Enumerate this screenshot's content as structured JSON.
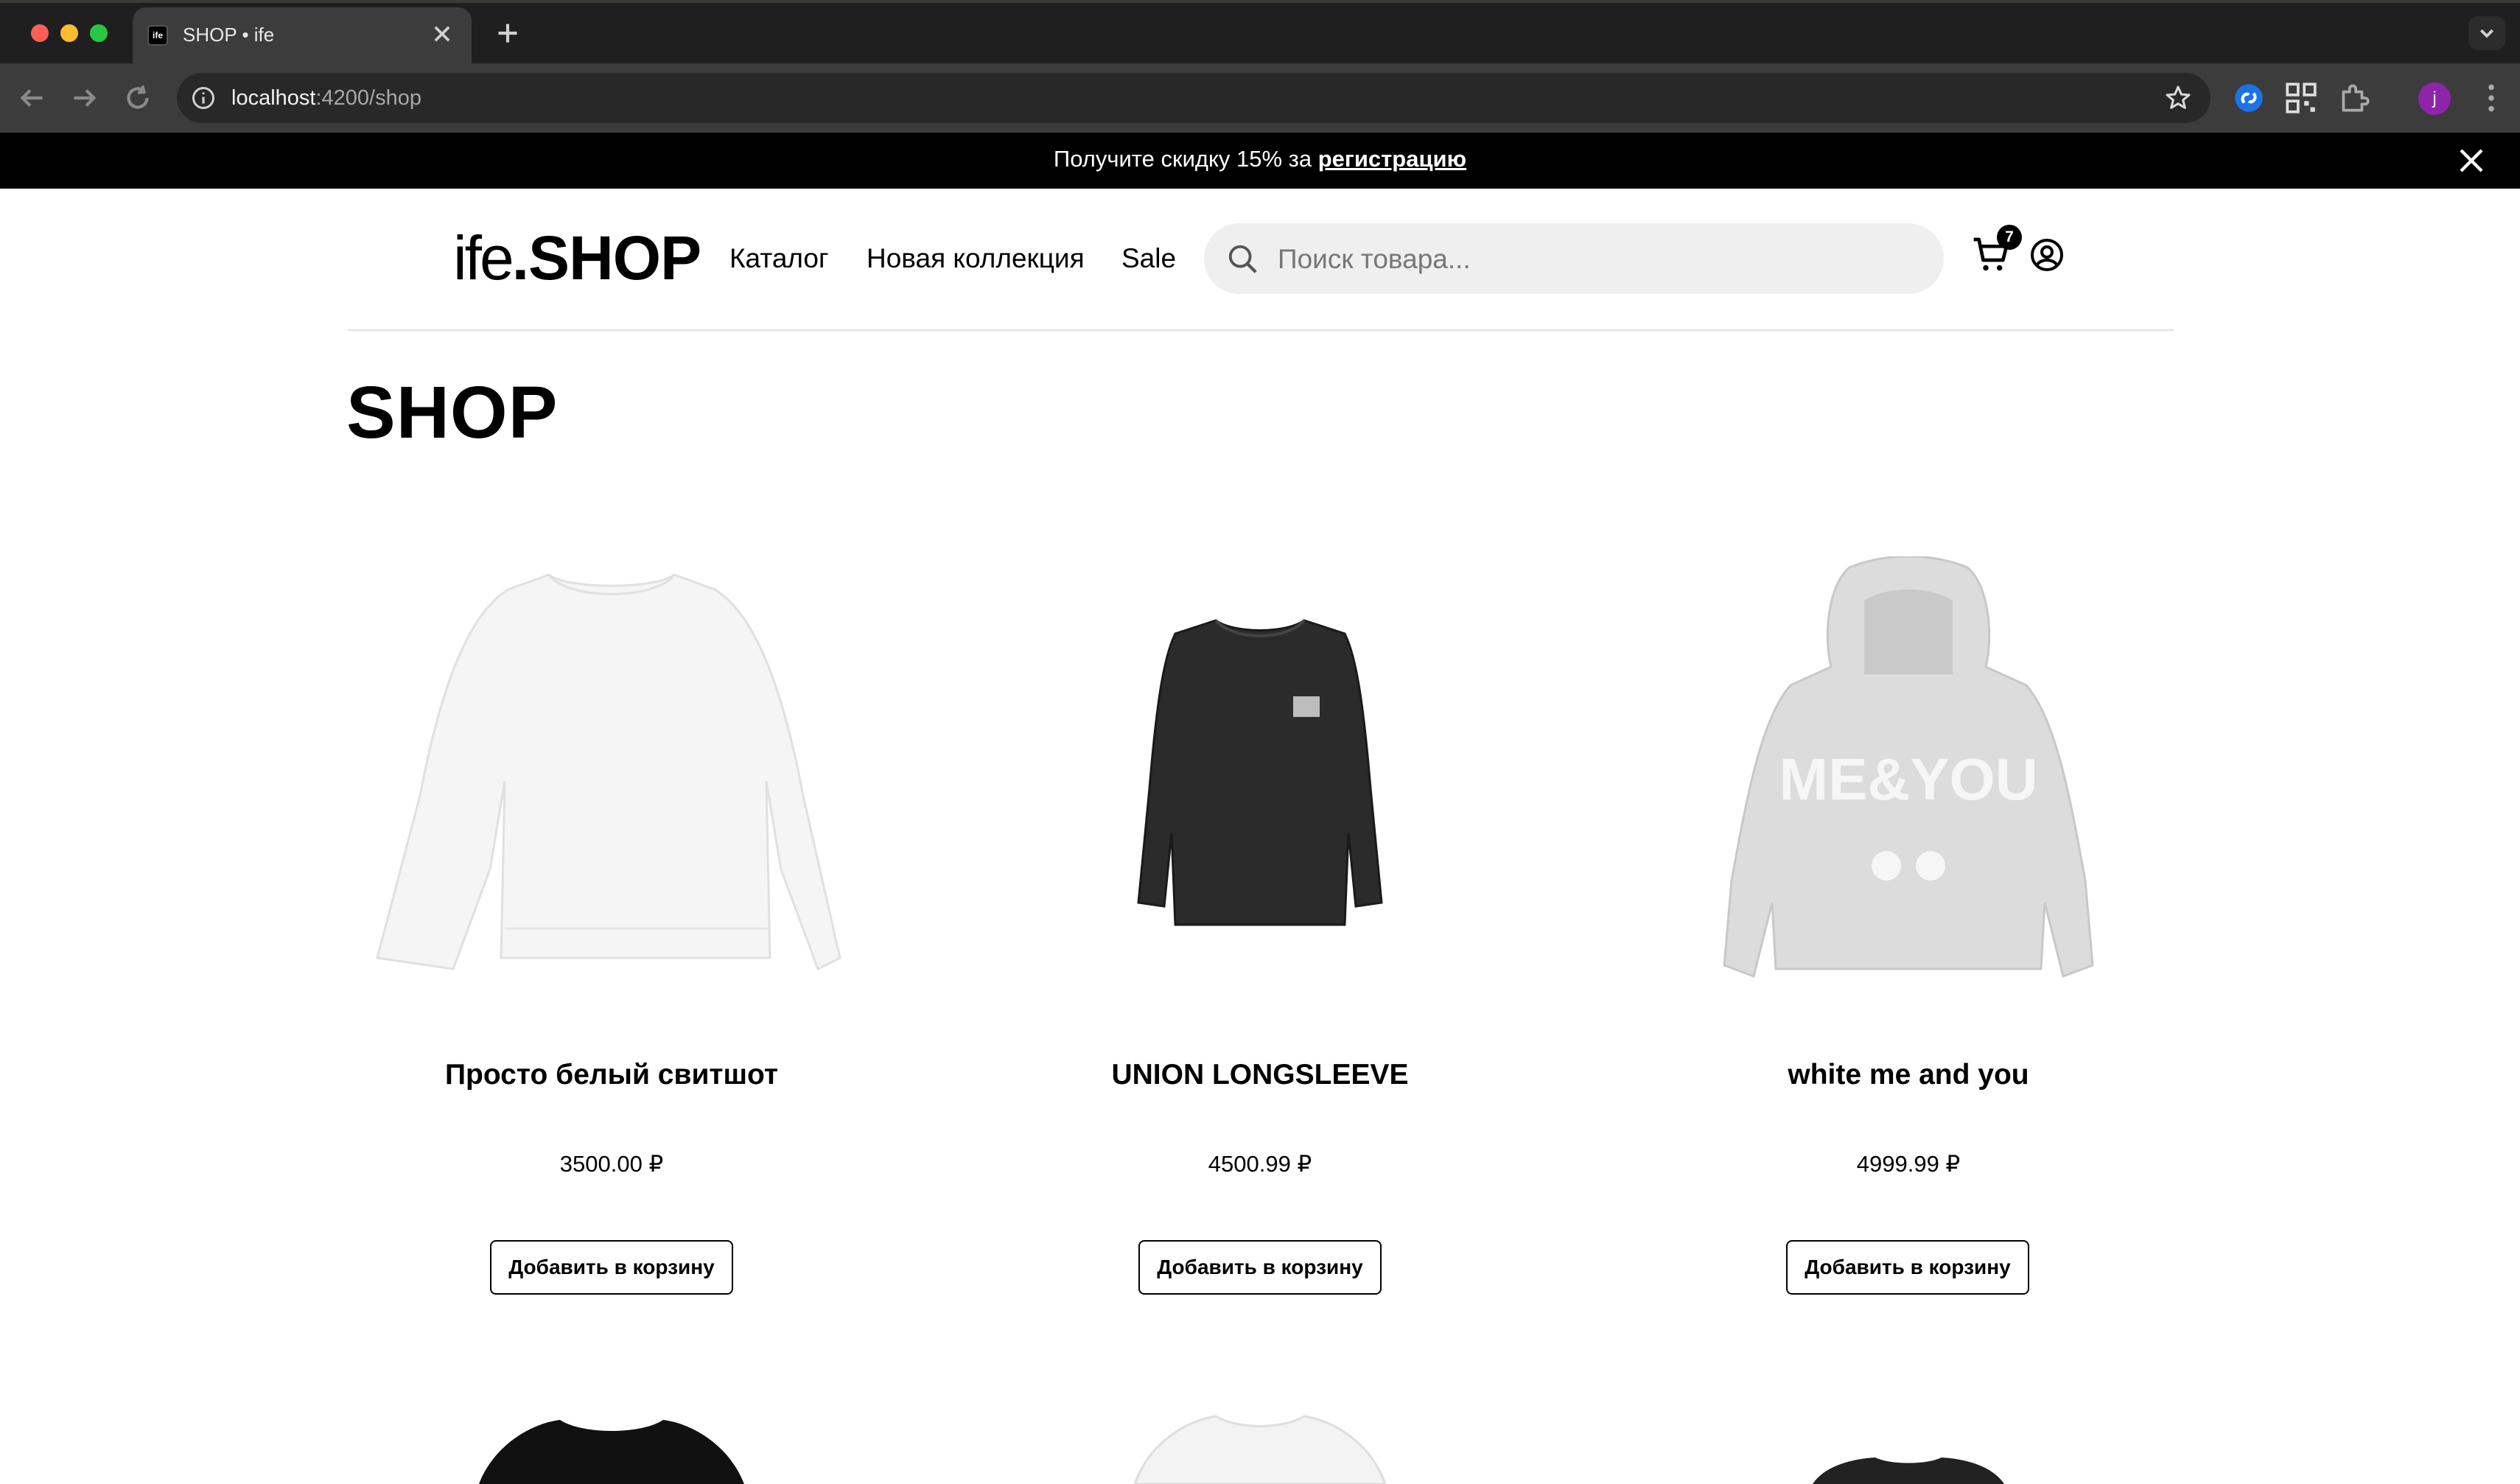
{
  "browser": {
    "tab_title": "SHOP • ife",
    "url_host": "localhost",
    "url_path": ":4200/shop",
    "profile_initial": "j",
    "colors": {
      "chrome_bg": "#1f1f1f",
      "toolbar_bg": "#3c3c3c",
      "omnibox_bg": "#282828"
    }
  },
  "promo": {
    "text": "Получите скидку 15% за ",
    "link": "регистрацию"
  },
  "header": {
    "logo_light": "ife",
    "logo_bold": ".SHOP",
    "nav": [
      "Каталог",
      "Новая коллекция",
      "Sale"
    ],
    "search_placeholder": "Поиск товара...",
    "cart_count": "7"
  },
  "page": {
    "title": "SHOP"
  },
  "products": [
    {
      "name": "Просто белый свитшот",
      "price": "3500.00 ₽",
      "button": "Добавить в корзину",
      "image": "white-sweatshirt"
    },
    {
      "name": "UNION LONGSLEEVE",
      "price": "4500.99 ₽",
      "button": "Добавить в корзину",
      "image": "black-longsleeve"
    },
    {
      "name": "white me and you",
      "price": "4999.99 ₽",
      "button": "Добавить в корзину",
      "image": "grey-hoodie"
    }
  ]
}
